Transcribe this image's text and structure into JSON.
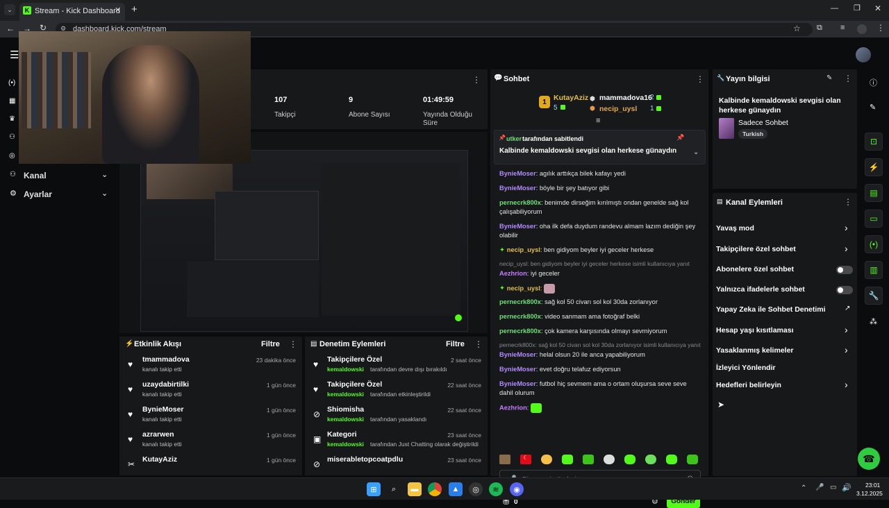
{
  "browser": {
    "tab_title": "Stream - Kick Dashboard",
    "url": "dashboard.kick.com/stream",
    "new_tab": "+"
  },
  "sidebar": {
    "kanal": "Kanal",
    "ayarlar": "Ayarlar"
  },
  "stats": {
    "followers_value": "107",
    "followers_label": "Takipçi",
    "subs_value": "9",
    "subs_label": "Abone Sayısı",
    "uptime_value": "01:49:59",
    "uptime_label": "Yayında Olduğu Süre"
  },
  "chat": {
    "title": "Sohbet",
    "top1_name": "KutayAziz",
    "top1_count": "5",
    "top1_rank": "1",
    "top2_name": "mammadova16",
    "top2_count": "2",
    "top3_name": "necip_uysl",
    "top3_count": "1",
    "pinned_by": "utker",
    "pinned_label": "tarafından sabitlendi",
    "pinned_text": "Kalbinde kemaldowski sevgisi olan herkese günaydın",
    "messages": [
      {
        "user": "BynieMoser",
        "color": "#b28cff",
        "text": "agılık arttıkça bilek kafayı yedi"
      },
      {
        "user": "BynieMoser",
        "color": "#b28cff",
        "text": "böyle bir şey batıyor gibi"
      },
      {
        "user": "pernecrk800x",
        "color": "#6fe07a",
        "text": "benimde dirseğim kırılmıştı ondan genelde sağ kol çalışabiliyorum"
      },
      {
        "user": "BynieMoser",
        "color": "#b28cff",
        "text": "oha ilk defa duydum randevu almam lazım dediğin şey olabilir"
      },
      {
        "user": "necip_uysl",
        "color": "#e3c04a",
        "text": "ben gidiyom beyler iyi geceler herkese"
      },
      {
        "system": "necip_uysl: ben gidiyom beyler iyi geceler herkese isimli kullanıcıya yanıt"
      },
      {
        "user": "Aezhrion",
        "color": "#c77dff",
        "text": "iyi geceler"
      },
      {
        "user": "necip_uysl",
        "color": "#e3c04a",
        "text": ""
      },
      {
        "user": "pernecrk800x",
        "color": "#6fe07a",
        "text": "sağ kol 50 civarı sol kol 30da zorlanıyor"
      },
      {
        "user": "pernecrk800x",
        "color": "#6fe07a",
        "text": "video sanmam ama fotoğraf belki"
      },
      {
        "user": "pernecrk800x",
        "color": "#6fe07a",
        "text": "çok kamera karşısında olmayı sevmiyorum"
      },
      {
        "system": "pernecrk800x: sağ kol 50 civarı sol kol 30da zorlanıyor isimli kullanıcıya yanıt"
      },
      {
        "user": "BynieMoser",
        "color": "#b28cff",
        "text": "helal olsun 20 ile anca yapabiliyorum"
      },
      {
        "user": "BynieMoser",
        "color": "#b28cff",
        "text": "evet doğru telafuz ediyorsun"
      },
      {
        "user": "BynieMoser",
        "color": "#b28cff",
        "text": "futbol hiç sevmem ama o ortam oluşursa seve seve dahil olurum"
      },
      {
        "user": "Aezhrion",
        "color": "#c77dff",
        "text": ""
      }
    ],
    "input_placeholder": "Bir mesaj gönderin",
    "points": "0",
    "send_button": "Gönder"
  },
  "stream_info": {
    "title": "Yayın bilgisi",
    "stream_title": "Kalbinde kemaldowski sevgisi olan herkese günaydın",
    "category": "Sadece Sohbet",
    "language": "Turkish"
  },
  "channel_actions": {
    "title": "Kanal Eylemleri",
    "items": [
      {
        "label": "Yavaş mod",
        "type": "chevron"
      },
      {
        "label": "Takipçilere özel sohbet",
        "type": "chevron"
      },
      {
        "label": "Abonelere özel sohbet",
        "type": "toggle"
      },
      {
        "label": "Yalnızca ifadelerle sohbet",
        "type": "toggle"
      },
      {
        "label": "Yapay Zeka ile Sohbet Denetimi",
        "type": "external"
      },
      {
        "label": "Hesap yaşı kısıtlaması",
        "type": "chevron"
      },
      {
        "label": "Yasaklanmış kelimeler",
        "type": "chevron"
      },
      {
        "label": "İzleyici Yönlendir",
        "type": "none"
      },
      {
        "label": "Hedefleri belirleyin",
        "type": "chevron"
      }
    ]
  },
  "activity_feed": {
    "title": "Etkinlik Akışı",
    "filter": "Filtre",
    "items": [
      {
        "name": "tmammadova",
        "sub": "kanalı takip etti",
        "time": "23 dakika önce"
      },
      {
        "name": "uzaydabirtilki",
        "sub": "kanalı takip etti",
        "time": "1 gün önce"
      },
      {
        "name": "BynieMoser",
        "sub": "kanalı takip etti",
        "time": "1 gün önce"
      },
      {
        "name": "azrarwen",
        "sub": "kanalı takip etti",
        "time": "1 gün önce"
      },
      {
        "name": "KutayAziz",
        "sub": "",
        "time": "1 gün önce"
      }
    ]
  },
  "mod_actions": {
    "title": "Denetim Eylemleri",
    "filter": "Filtre",
    "items": [
      {
        "name": "Takipçilere Özel",
        "actor": "kemaldowski",
        "rest": "tarafından devre dışı bırakıldı",
        "time": "2 saat önce"
      },
      {
        "name": "Takipçilere Özel",
        "actor": "kemaldowski",
        "rest": "tarafından etkinleştirildi",
        "time": "22 saat önce"
      },
      {
        "name": "Shiomisha",
        "actor": "kemaldowski",
        "rest": "tarafından yasaklandı",
        "time": "22 saat önce"
      },
      {
        "name": "Kategori",
        "actor": "kemaldowski",
        "rest": "tarafından Just Chatting olarak değiştirildi",
        "time": "23 saat önce"
      },
      {
        "name": "miserabletopcoatpdlu",
        "actor": "",
        "rest": "",
        "time": "23 saat önce"
      }
    ]
  },
  "taskbar": {
    "time": "23:01",
    "date": "3.12.2025"
  },
  "colors": {
    "accent": "#53fc18",
    "panel": "#17181a",
    "bg": "#0b0c0d"
  }
}
